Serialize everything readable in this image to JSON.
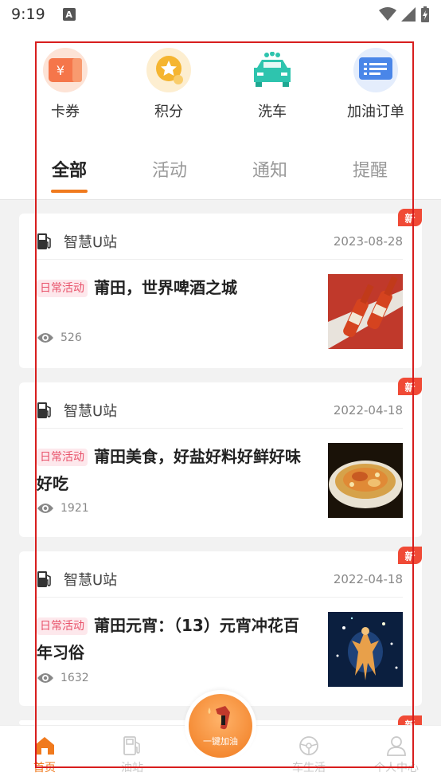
{
  "status": {
    "time": "9:19",
    "badge": "A"
  },
  "quick_links": [
    {
      "label": "卡券",
      "icon": "coupon-icon",
      "color": "#f5764a"
    },
    {
      "label": "积分",
      "icon": "points-star-icon",
      "color": "#f5b530"
    },
    {
      "label": "洗车",
      "icon": "car-wash-icon",
      "color": "#2ec4ae"
    },
    {
      "label": "加油订单",
      "icon": "fuel-order-icon",
      "color": "#4a86e8"
    }
  ],
  "tabs": [
    "全部",
    "活动",
    "通知",
    "提醒"
  ],
  "active_tab": "全部",
  "cards": [
    {
      "new_badge": "新",
      "source": "智慧U站",
      "date": "2023-08-28",
      "tag": "日常活动",
      "title": "莆田，世界啤酒之城",
      "views": "526"
    },
    {
      "new_badge": "新",
      "source": "智慧U站",
      "date": "2022-04-18",
      "tag": "日常活动",
      "title": "莆田美食，好盐好料好鲜好味好吃",
      "views": "1921"
    },
    {
      "new_badge": "新",
      "source": "智慧U站",
      "date": "2022-04-18",
      "tag": "日常活动",
      "title": "莆田元宵：（13）元宵冲花百年习俗",
      "views": "1632"
    }
  ],
  "peek_badge": "新",
  "bottom_nav": {
    "home": "首页",
    "station": "油站",
    "fab": "一键加油",
    "car_life": "车生活",
    "profile": "个人中心"
  },
  "colors": {
    "accent": "#f07a1e",
    "tag": "#e8526a",
    "new": "#f04a36"
  }
}
